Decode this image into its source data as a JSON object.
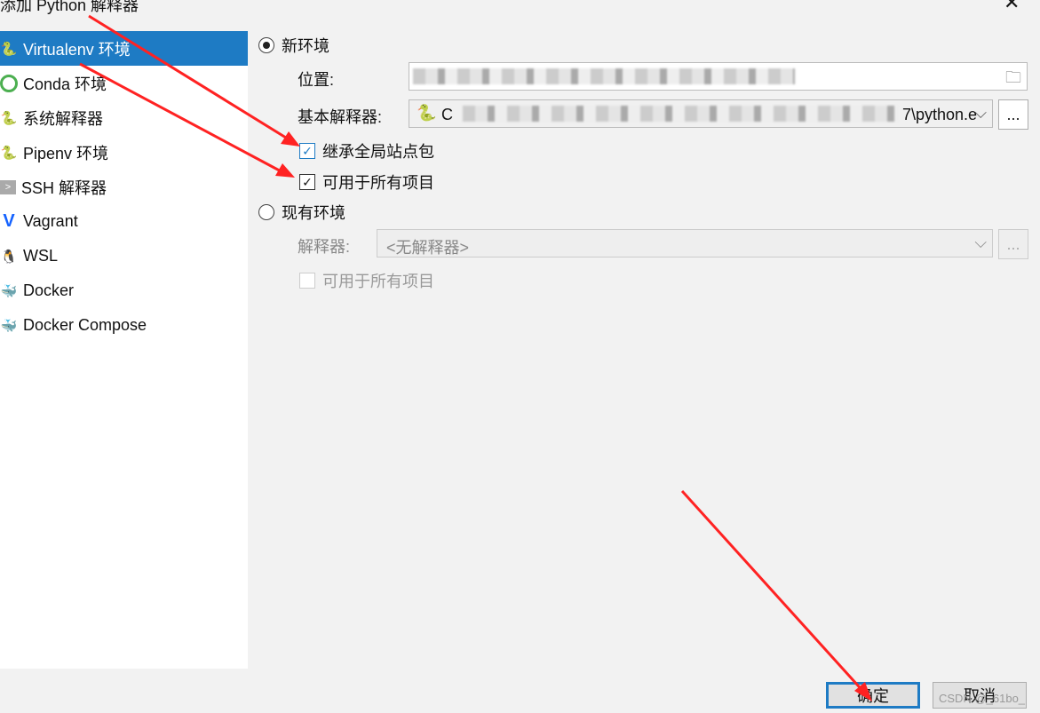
{
  "window": {
    "title": "添加 Python 解释器",
    "close": "✕"
  },
  "sidebar": {
    "items": [
      {
        "label": "Virtualenv 环境",
        "icon": "virtualenv-icon",
        "selected": true
      },
      {
        "label": "Conda 环境",
        "icon": "conda-icon"
      },
      {
        "label": "系统解释器",
        "icon": "python-icon"
      },
      {
        "label": "Pipenv 环境",
        "icon": "pipenv-icon"
      },
      {
        "label": "SSH 解释器",
        "icon": "ssh-icon"
      },
      {
        "label": "Vagrant",
        "icon": "vagrant-icon"
      },
      {
        "label": "WSL",
        "icon": "linux-icon"
      },
      {
        "label": "Docker",
        "icon": "docker-icon"
      },
      {
        "label": "Docker Compose",
        "icon": "docker-compose-icon"
      }
    ]
  },
  "new_env": {
    "label": "新环境",
    "selected": true,
    "location_label": "位置:",
    "base_label": "基本解释器:",
    "base_value_start": "C",
    "base_value_end": "7\\python.e",
    "inherit_label": "继承全局站点包",
    "inherit_checked": true,
    "all_projects_label": "可用于所有项目",
    "all_projects_checked": true,
    "more": "..."
  },
  "existing_env": {
    "label": "现有环境",
    "selected": false,
    "interpreter_label": "解释器:",
    "interpreter_value": "<无解释器>",
    "all_projects_label": "可用于所有项目",
    "more": "..."
  },
  "footer": {
    "ok": "确定",
    "cancel": "取消",
    "watermark": "CSDN @_61bo_"
  },
  "colors": {
    "accent": "#1e7bc4",
    "arrow": "#ff2222"
  }
}
